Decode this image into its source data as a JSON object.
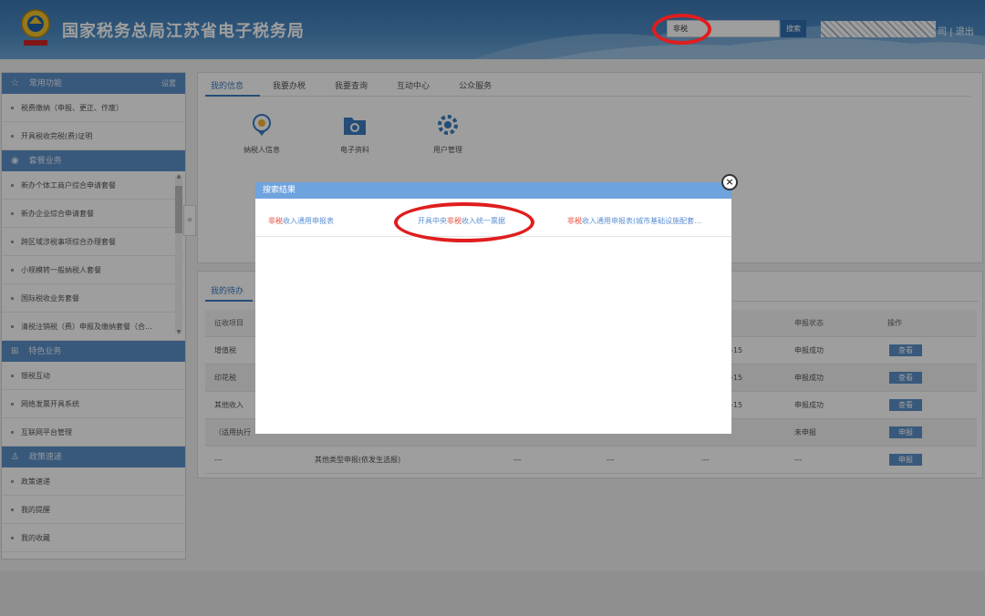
{
  "header": {
    "title": "国家税务总局江苏省电子税务局",
    "search_value": "非税",
    "search_button": "搜索",
    "user_redacted": "",
    "links": "司 | 退出"
  },
  "sidebar": {
    "sections": [
      {
        "icon": "star-icon",
        "title": "常用功能",
        "setting": "设置",
        "items": [
          "税费缴纳（申报、更正、作废）",
          "开具税收完税(费)证明"
        ]
      },
      {
        "icon": "package-icon",
        "title": "套餐业务",
        "items": [
          "新办个体工商户综合申请套餐",
          "新办企业综合申请套餐",
          "跨区域涉税事项综合办理套餐",
          "小规模转一般纳税人套餐",
          "国际税收业务套餐",
          "清税注销税（费）申报及缴纳套餐（合..."
        ]
      },
      {
        "icon": "grid-icon",
        "title": "特色业务",
        "items": [
          "银税互动",
          "网络发票开具系统",
          "互联网平台管理"
        ]
      },
      {
        "icon": "person-icon",
        "title": "政策速递",
        "items": [
          "政策速递",
          "我的提醒",
          "我的收藏"
        ]
      }
    ]
  },
  "main": {
    "tabs": [
      "我的信息",
      "我要办税",
      "我要查询",
      "互动中心",
      "公众服务"
    ],
    "quick_links": [
      {
        "label": "纳税人信息",
        "icon": "taxpayer-info-icon"
      },
      {
        "label": "电子资料",
        "icon": "e-documents-icon"
      },
      {
        "label": "用户管理",
        "icon": "user-management-icon"
      }
    ]
  },
  "todo": {
    "tab": "我的待办",
    "columns": [
      "征收项目",
      "申报状态",
      "操作"
    ],
    "rows": [
      {
        "item": "增值税",
        "date": "-15",
        "status": "申报成功",
        "action": "查看"
      },
      {
        "item": "印花税",
        "date": "-15",
        "status": "申报成功",
        "action": "查看"
      },
      {
        "item": "其他收入",
        "date": "-15",
        "status": "申报成功",
        "action": "查看"
      },
      {
        "item": "（适用执行",
        "date": "",
        "status": "未申报",
        "action": "申报"
      },
      {
        "item": "---",
        "name": "其他类型申报(依发生选报)",
        "c3": "---",
        "c4": "---",
        "c5": "---",
        "status": "---",
        "action": "申报"
      }
    ]
  },
  "modal": {
    "title": "搜索结果",
    "results": [
      {
        "hl": "非税",
        "rest": "收入通用申报表"
      },
      {
        "pre": "开具中央",
        "hl": "非税",
        "rest": "收入统一票据"
      },
      {
        "hl": "非税",
        "rest": "收入通用申报表(城市基础设施配套..."
      }
    ]
  },
  "colors": {
    "accent": "#3a7cc1",
    "annotation": "#e01d1d",
    "highlight": "#e8483a"
  }
}
